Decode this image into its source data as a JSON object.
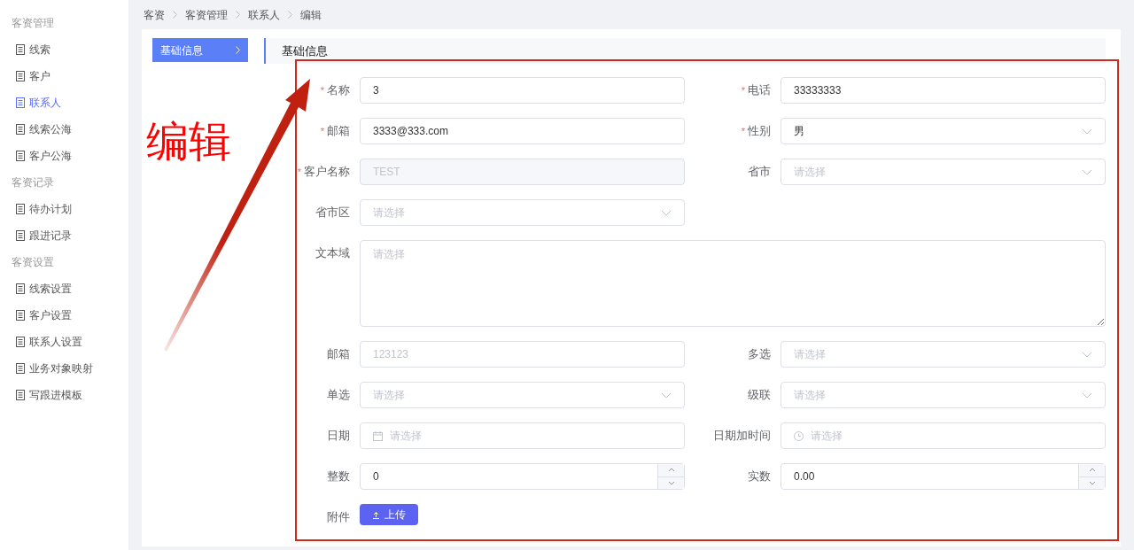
{
  "sidebar": {
    "groups": [
      {
        "title": "客资管理",
        "items": [
          {
            "label": "线索",
            "selected": false
          },
          {
            "label": "客户",
            "selected": false
          },
          {
            "label": "联系人",
            "selected": true
          },
          {
            "label": "线索公海",
            "selected": false
          },
          {
            "label": "客户公海",
            "selected": false
          }
        ]
      },
      {
        "title": "客资记录",
        "items": [
          {
            "label": "待办计划",
            "selected": false
          },
          {
            "label": "跟进记录",
            "selected": false
          }
        ]
      },
      {
        "title": "客资设置",
        "items": [
          {
            "label": "线索设置",
            "selected": false
          },
          {
            "label": "客户设置",
            "selected": false
          },
          {
            "label": "联系人设置",
            "selected": false
          },
          {
            "label": "业务对象映射",
            "selected": false
          },
          {
            "label": "写跟进模板",
            "selected": false
          }
        ]
      }
    ]
  },
  "breadcrumb": [
    "客资",
    "客资管理",
    "联系人",
    "编辑"
  ],
  "side_tabs": [
    {
      "label": "基础信息",
      "selected": true
    }
  ],
  "section_title": "基础信息",
  "form": {
    "required_mark": "*",
    "rows": [
      [
        {
          "label": "名称",
          "required": true,
          "kind": "text",
          "value": "3"
        },
        {
          "label": "电话",
          "required": true,
          "kind": "text",
          "value": "33333333"
        }
      ],
      [
        {
          "label": "邮箱",
          "required": true,
          "kind": "text",
          "value": "3333@333.com"
        },
        {
          "label": "性别",
          "required": true,
          "kind": "select",
          "value": "男"
        }
      ],
      [
        {
          "label": "客户名称",
          "required": true,
          "kind": "disabled",
          "value": "TEST"
        },
        {
          "label": "省市",
          "required": false,
          "kind": "select",
          "placeholder": "请选择"
        }
      ],
      [
        {
          "label": "省市区",
          "required": false,
          "kind": "select",
          "placeholder": "请选择"
        }
      ],
      [
        {
          "label": "文本域",
          "required": false,
          "kind": "textarea",
          "placeholder": "请选择"
        }
      ],
      [
        {
          "label": "邮箱",
          "required": false,
          "kind": "text",
          "placeholder": "123123"
        },
        {
          "label": "多选",
          "required": false,
          "kind": "select",
          "placeholder": "请选择"
        }
      ],
      [
        {
          "label": "单选",
          "required": false,
          "kind": "select",
          "placeholder": "请选择"
        },
        {
          "label": "级联",
          "required": false,
          "kind": "select",
          "placeholder": "请选择"
        }
      ],
      [
        {
          "label": "日期",
          "required": false,
          "kind": "date",
          "placeholder": "请选择"
        },
        {
          "label": "日期加时间",
          "required": false,
          "kind": "datetime",
          "placeholder": "请选择"
        }
      ],
      [
        {
          "label": "整数",
          "required": false,
          "kind": "number",
          "value": "0"
        },
        {
          "label": "实数",
          "required": false,
          "kind": "number",
          "value": "0.00"
        }
      ],
      [
        {
          "label": "附件",
          "required": false,
          "kind": "upload",
          "button": "上传"
        }
      ]
    ]
  },
  "annotation": {
    "text": "编辑"
  }
}
